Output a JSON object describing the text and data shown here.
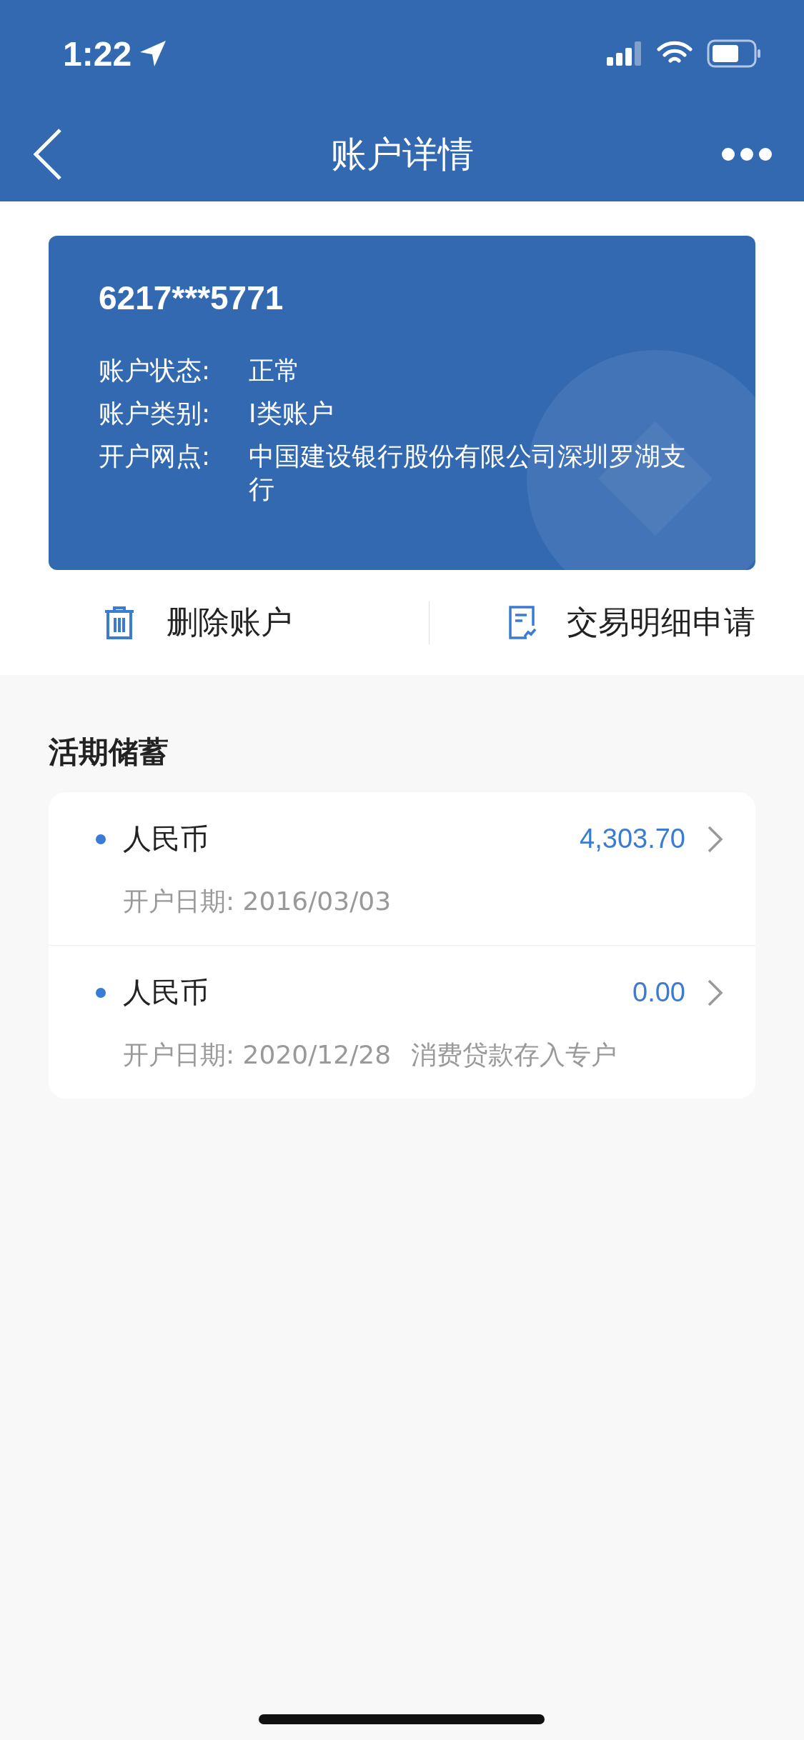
{
  "status_bar": {
    "time": "1:22"
  },
  "nav": {
    "title": "账户详情"
  },
  "card": {
    "number": "6217***5771",
    "info": [
      {
        "label": "账户状态:",
        "value": "正常"
      },
      {
        "label": "账户类别:",
        "value": "I类账户"
      },
      {
        "label": "开户网点:",
        "value": "中国建设银行股份有限公司深圳罗湖支行"
      }
    ]
  },
  "actions": [
    {
      "kind": "delete",
      "label": "删除账户"
    },
    {
      "kind": "statement",
      "label": "交易明细申请"
    }
  ],
  "section": {
    "title": "活期储蓄",
    "accounts": [
      {
        "currency": "人民币",
        "balance": "4,303.70",
        "open_date": "开户日期: 2016/03/03"
      },
      {
        "currency": "人民币",
        "balance": "0.00",
        "open_date": "开户日期: 2020/12/28",
        "note": "消费贷款存入专户"
      }
    ]
  }
}
